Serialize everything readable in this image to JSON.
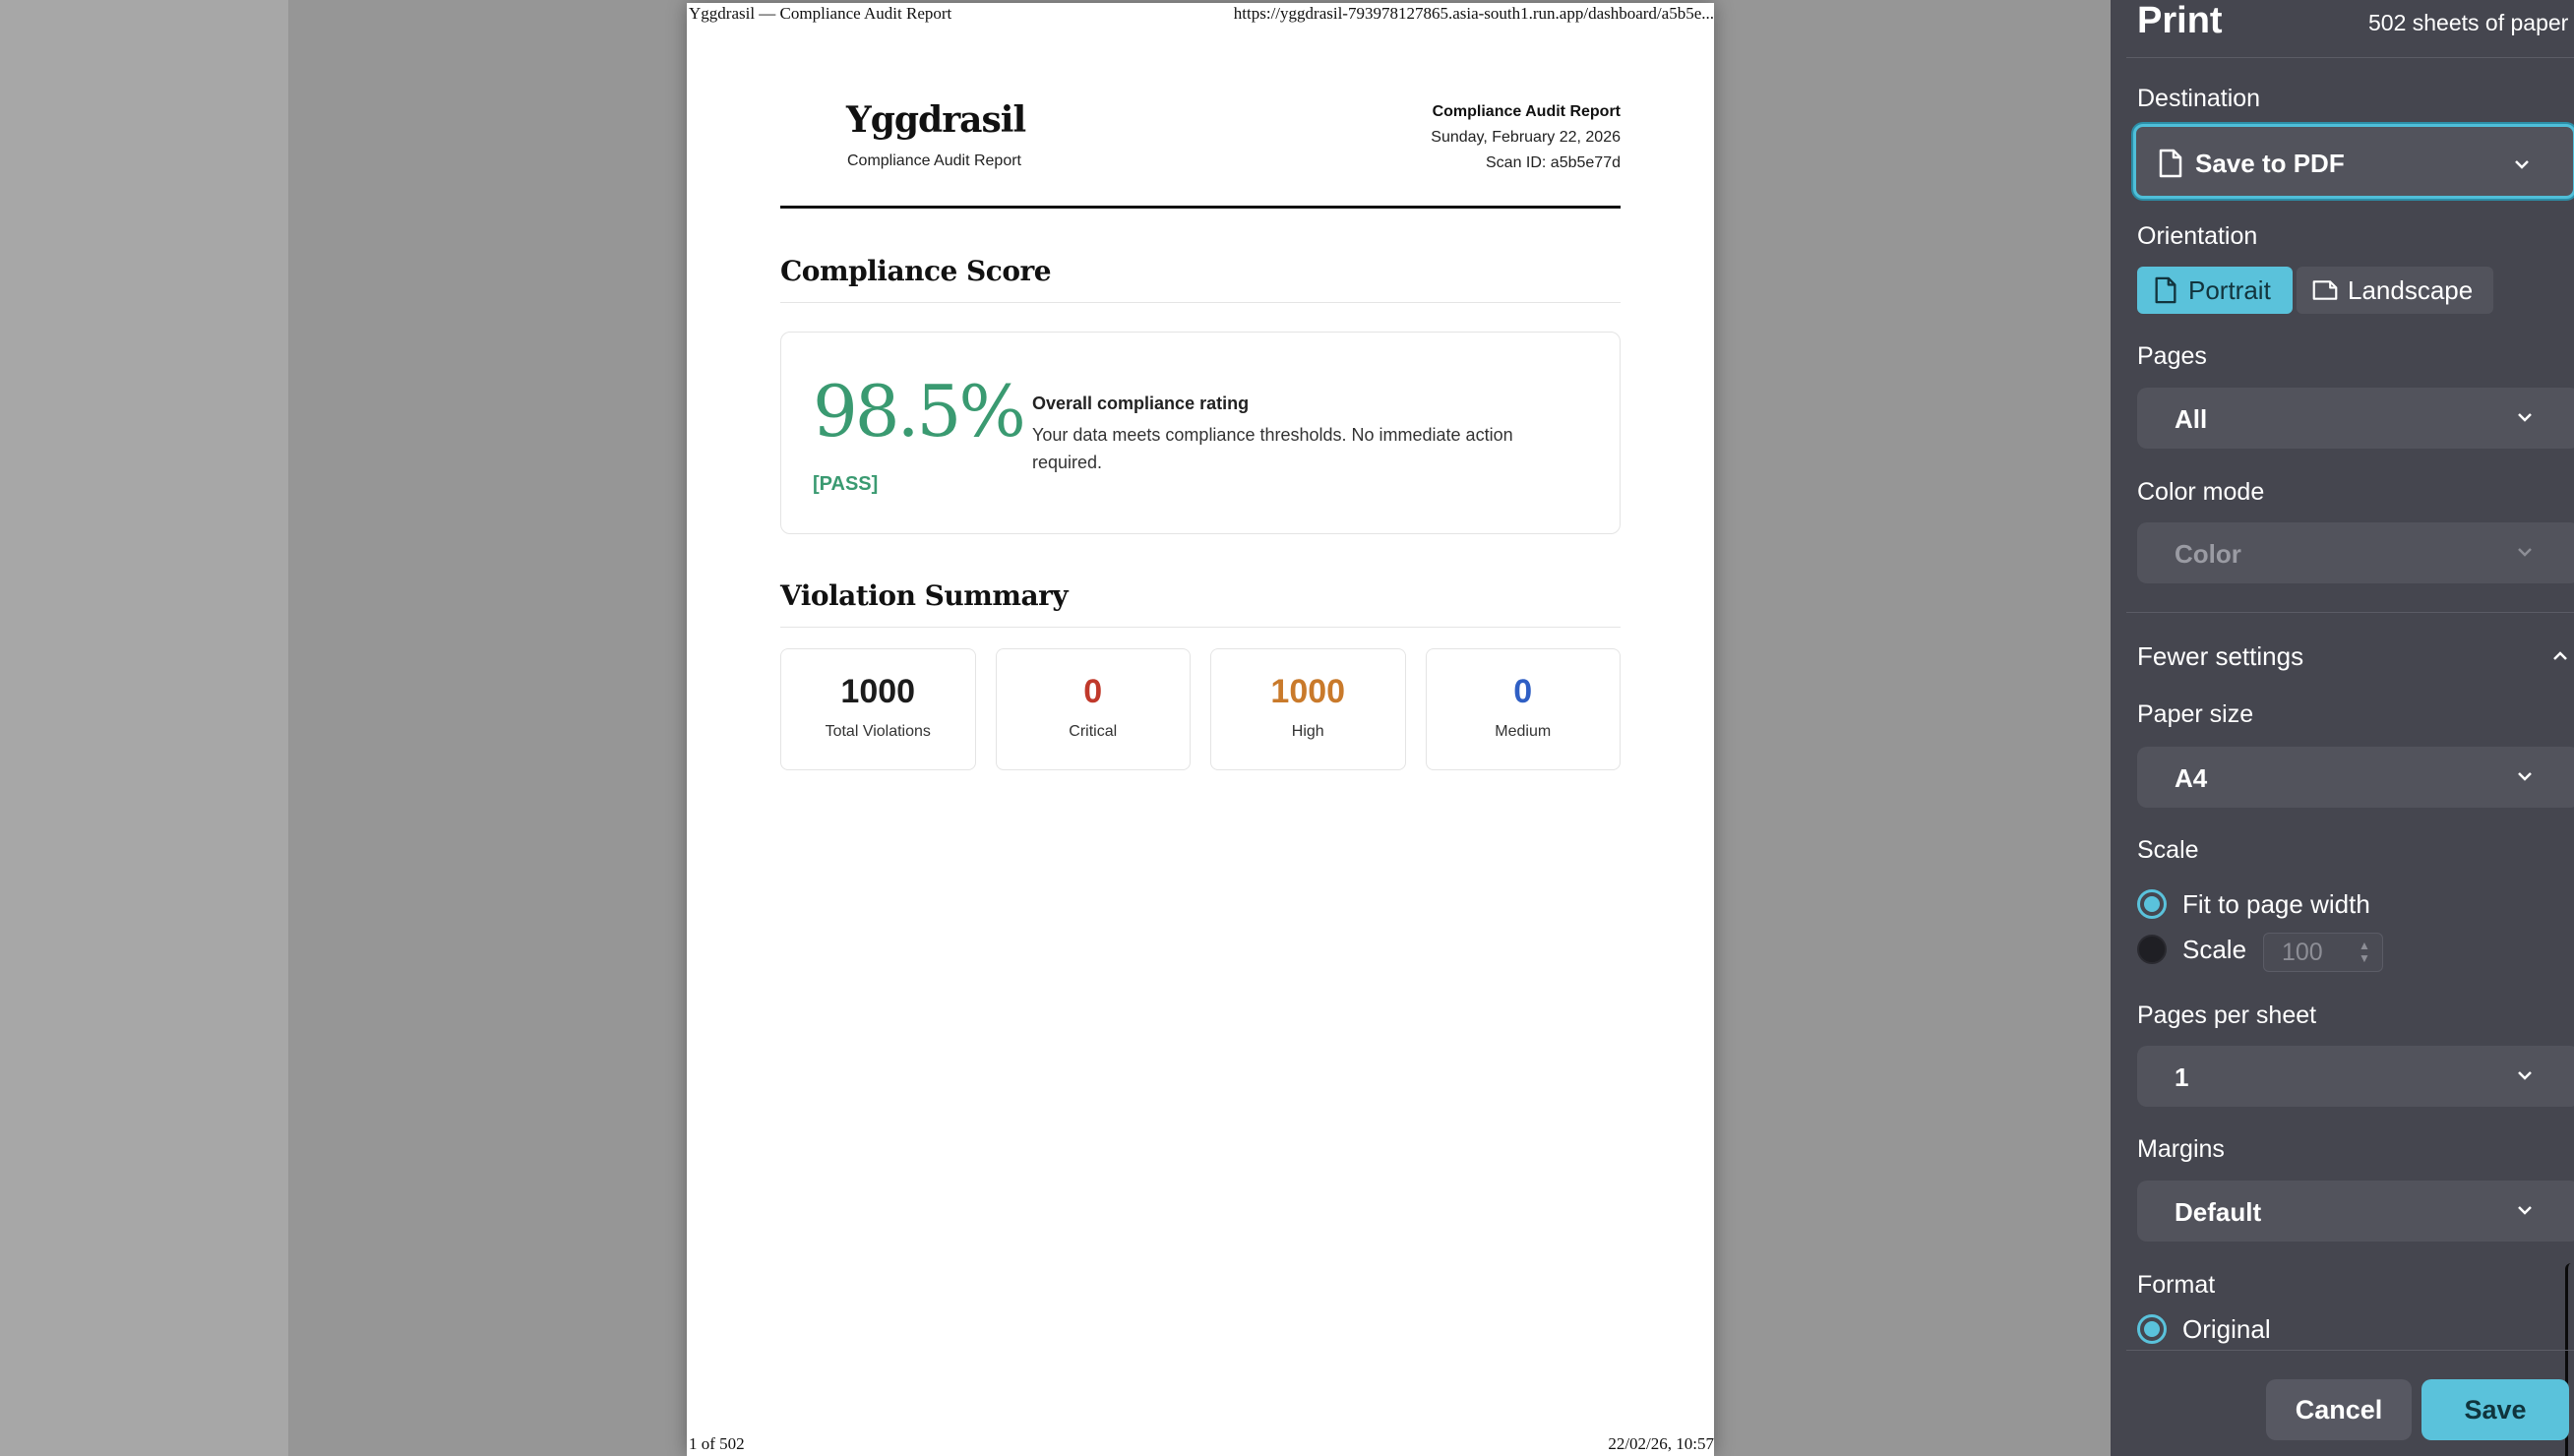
{
  "document": {
    "header_left": "Yggdrasil — Compliance Audit Report",
    "header_right": "https://yggdrasil-793978127865.asia-south1.run.app/dashboard/a5b5e...",
    "footer_left": "1 of 502",
    "footer_right": "22/02/26, 10:57",
    "brand": "Yggdrasil",
    "brand_subtitle": "Compliance Audit Report",
    "meta_title": "Compliance Audit Report",
    "meta_date": "Sunday, February 22, 2026",
    "meta_scan": "Scan ID: a5b5e77d",
    "score_section_title": "Compliance Score",
    "score_value": "98.5%",
    "score_status": "[PASS]",
    "score_heading": "Overall compliance rating",
    "score_description": "Your data meets compliance thresholds. No immediate action required.",
    "violations_section_title": "Violation Summary",
    "stats": [
      {
        "value": "1000",
        "label": "Total Violations",
        "color": "#1c1c1c"
      },
      {
        "value": "0",
        "label": "Critical",
        "color": "#c0392b"
      },
      {
        "value": "1000",
        "label": "High",
        "color": "#c97a2b"
      },
      {
        "value": "0",
        "label": "Medium",
        "color": "#2f5fc4"
      }
    ]
  },
  "print": {
    "title": "Print",
    "sheets": "502 sheets of paper",
    "destination_label": "Destination",
    "destination_value": "Save to PDF",
    "orientation_label": "Orientation",
    "portrait": "Portrait",
    "landscape": "Landscape",
    "pages_label": "Pages",
    "pages_value": "All",
    "color_label": "Color mode",
    "color_value": "Color",
    "fewer_settings": "Fewer settings",
    "paper_label": "Paper size",
    "paper_value": "A4",
    "scale_label": "Scale",
    "scale_fit": "Fit to page width",
    "scale_custom": "Scale",
    "scale_value": "100",
    "pps_label": "Pages per sheet",
    "pps_value": "1",
    "margins_label": "Margins",
    "margins_value": "Default",
    "format_label": "Format",
    "format_value": "Original",
    "cancel": "Cancel",
    "save": "Save",
    "accent": "#5ac2db"
  }
}
